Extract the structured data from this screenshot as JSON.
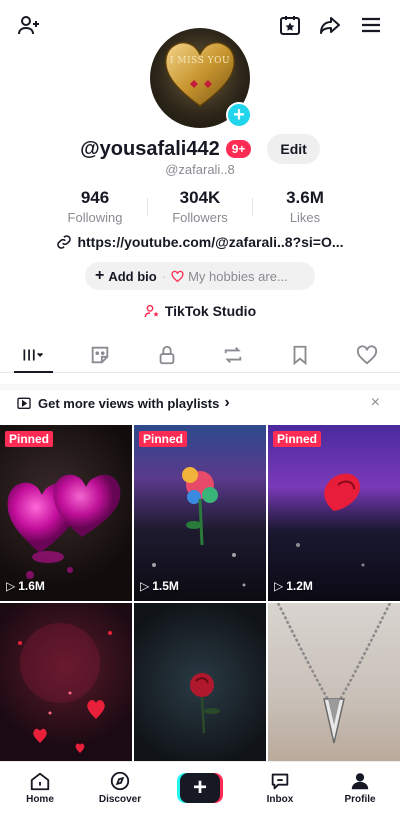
{
  "profile": {
    "username": "@yousafali442",
    "notif_count": "9+",
    "edit_label": "Edit",
    "handle": "@zafarali..8",
    "avatar_text": "I MISS YOU",
    "link": "https://youtube.com/@zafarali..8?si=O...",
    "add_bio": "Add bio",
    "hobbies": "My hobbies are...",
    "studio": "TikTok Studio"
  },
  "stats": [
    {
      "value": "946",
      "label": "Following"
    },
    {
      "value": "304K",
      "label": "Followers"
    },
    {
      "value": "3.6M",
      "label": "Likes"
    }
  ],
  "promo": {
    "text": "Get more views with playlists",
    "chevron": "›",
    "close": "×"
  },
  "videos": [
    {
      "pinned": "Pinned",
      "views": "1.6M"
    },
    {
      "pinned": "Pinned",
      "views": "1.5M"
    },
    {
      "pinned": "Pinned",
      "views": "1.2M"
    },
    {
      "pinned": "",
      "views": ""
    },
    {
      "pinned": "",
      "views": ""
    },
    {
      "pinned": "",
      "views": ""
    }
  ],
  "nav": {
    "home": "Home",
    "discover": "Discover",
    "create": "+",
    "inbox": "Inbox",
    "profile": "Profile"
  },
  "icons": {
    "add_friend": "add-friend-icon",
    "calendar_star": "calendar-star-icon",
    "share": "share-icon",
    "menu": "menu-icon"
  },
  "colors": {
    "brand_red": "#fe2c55",
    "brand_cyan": "#25f4ee",
    "accent_blue": "#20d5ec"
  }
}
